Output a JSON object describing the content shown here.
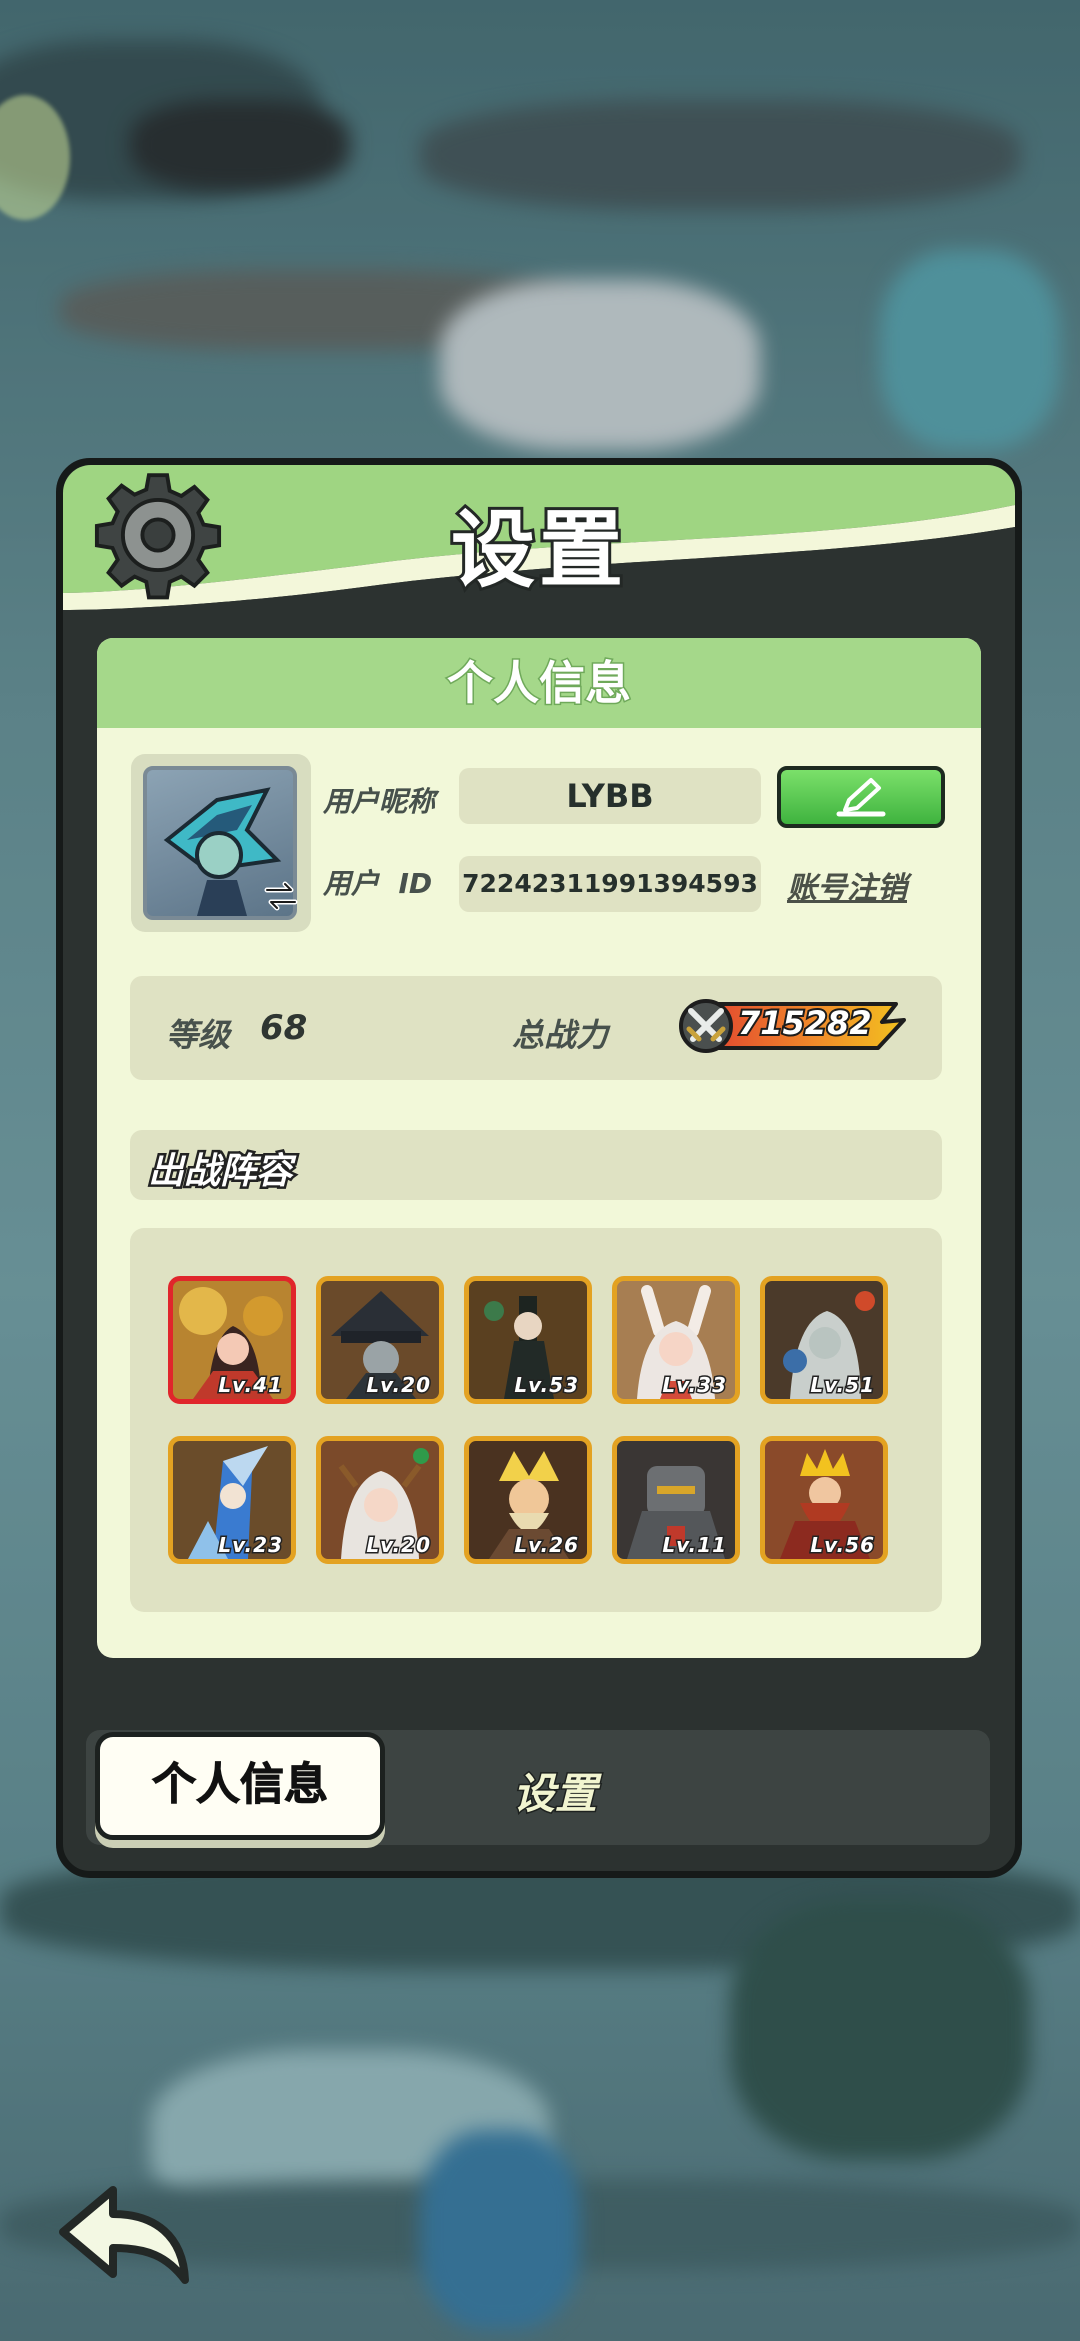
{
  "window": {
    "title": "设置"
  },
  "profile_card": {
    "header": "个人信息",
    "nickname_label": "用户昵称",
    "nickname": "LYBB",
    "id_label": "用户  ID",
    "user_id": "72242311991394593",
    "account_cancel": "账号注销"
  },
  "stats": {
    "level_label": "等级",
    "level": "68",
    "power_label": "总战力",
    "power": "715282"
  },
  "lineup": {
    "title": "出战阵容",
    "heroes": [
      {
        "level": "Lv.41"
      },
      {
        "level": "Lv.20"
      },
      {
        "level": "Lv.53"
      },
      {
        "level": "Lv.33"
      },
      {
        "level": "Lv.51"
      },
      {
        "level": "Lv.23"
      },
      {
        "level": "Lv.20"
      },
      {
        "level": "Lv.26"
      },
      {
        "level": "Lv.11"
      },
      {
        "level": "Lv.56"
      }
    ]
  },
  "tabs": {
    "profile": "个人信息",
    "settings": "设置"
  },
  "colors": {
    "accent_green": "#a5d88a",
    "card_bg": "#f2f8d9",
    "power_gold": "#f3c21f",
    "power_red": "#e2452f"
  },
  "icons": {
    "gear": "gear-icon",
    "edit": "pencil-icon",
    "switch": "swap-arrows-icon",
    "power": "crossed-swords-icon",
    "back": "back-arrow-icon"
  }
}
